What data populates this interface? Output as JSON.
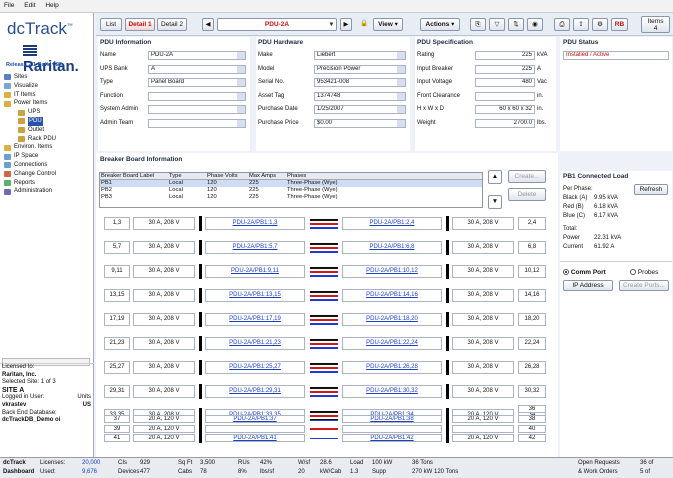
{
  "menu": [
    "File",
    "Edit",
    "Help"
  ],
  "app": {
    "logo": "dcTrack",
    "logo_tm": "™",
    "brand": "Raritan.",
    "release": "Release 2.1 Build 822"
  },
  "tree": [
    {
      "label": "Sites",
      "indent": 0,
      "color": "#5b7fc6"
    },
    {
      "label": "Visualize",
      "indent": 0,
      "color": "#79a6d8"
    },
    {
      "label": "IT Items",
      "indent": 0,
      "color": "#d9b046"
    },
    {
      "label": "Power Items",
      "indent": 0,
      "color": "#d9b046"
    },
    {
      "label": "UPS",
      "indent": 2,
      "color": "#cba23e"
    },
    {
      "label": "PDU",
      "indent": 2,
      "color": "#cba23e",
      "selected": true
    },
    {
      "label": "Outlet",
      "indent": 2,
      "color": "#cba23e"
    },
    {
      "label": "Rack PDU",
      "indent": 2,
      "color": "#cba23e"
    },
    {
      "label": "Environ. Items",
      "indent": 0,
      "color": "#d9b046"
    },
    {
      "label": "IP Space",
      "indent": 0,
      "color": "#6aa0d0"
    },
    {
      "label": "Connections",
      "indent": 0,
      "color": "#6aa0d0"
    },
    {
      "label": "Change Control",
      "indent": 0,
      "color": "#c86a46"
    },
    {
      "label": "Reports",
      "indent": 0,
      "color": "#5bb06a"
    },
    {
      "label": "Administration",
      "indent": 0,
      "color": "#6b6bb8"
    }
  ],
  "license": {
    "l1": "Licensed to:",
    "l2": "Raritan, Inc.",
    "l3": "Selected Site: 1 of 3",
    "l4": "SITE A",
    "l5": "Logged in User:",
    "l5b": "Units",
    "l6": "vkrastev",
    "l6b": "US",
    "l7": "Back End Database:",
    "l8": "dcTrackDB_Demo oi"
  },
  "toolbar": {
    "list": "List",
    "detail1": "Detail 1",
    "detail2": "Detail 2",
    "item": "PDU-2A",
    "view": "View",
    "actions": "Actions",
    "rb": "RB",
    "items_label": "Items",
    "items_count": "4"
  },
  "pdu_info": {
    "title": "PDU Information",
    "fields": [
      {
        "label": "Name",
        "value": "PDU-2A"
      },
      {
        "label": "UPS Bank",
        "value": "A"
      },
      {
        "label": "Type",
        "value": "Panel Board"
      },
      {
        "label": "Function",
        "value": ""
      },
      {
        "label": "System Admin",
        "value": ""
      },
      {
        "label": "Admin Team",
        "value": ""
      }
    ]
  },
  "pdu_hw": {
    "title": "PDU Hardware",
    "fields": [
      {
        "label": "Make",
        "value": "Liebert"
      },
      {
        "label": "Model",
        "value": "Precision Power"
      },
      {
        "label": "Serial No.",
        "value": "953421-008"
      },
      {
        "label": "Asset Tag",
        "value": "1374748"
      },
      {
        "label": "Purchase Date",
        "value": "1/25/2007"
      },
      {
        "label": "Purchase Price",
        "value": "$0.00"
      }
    ]
  },
  "pdu_spec": {
    "title": "PDU Specification",
    "fields": [
      {
        "label": "Rating",
        "value": "225",
        "unit": "kVA"
      },
      {
        "label": "Input Breaker",
        "value": "225",
        "unit": "A"
      },
      {
        "label": "Input Voltage",
        "value": "480",
        "unit": "Vac"
      },
      {
        "label": "Front Clearance",
        "value": "",
        "unit": "in."
      },
      {
        "label": "H x W x D",
        "value": "60 x 60 x 32",
        "unit": "in."
      },
      {
        "label": "Weight",
        "value": "2700.0",
        "unit": "lbs."
      }
    ]
  },
  "pdu_status": {
    "title": "PDU Status",
    "value": "Installed / Active"
  },
  "breaker_board": {
    "title": "Breaker Board Information",
    "headers": [
      "Breaker Board Label",
      "Type",
      "Phase Volts",
      "Max Amps",
      "Phases"
    ],
    "rows": [
      [
        "PB1",
        "Local",
        "120",
        "225",
        "Three-Phase (Wye)"
      ],
      [
        "PB2",
        "Local",
        "120",
        "225",
        "Three-Phase (Wye)"
      ],
      [
        "PB3",
        "Local",
        "120",
        "225",
        "Three-Phase (Wye)"
      ]
    ],
    "create": "Create...",
    "delete": "Delete"
  },
  "breakers": [
    {
      "l": "1,3",
      "la": "30 A, 208 V",
      "ll": "PDU-2A/PB1:1,3",
      "rl": "PDU-2A/PB1:2,4",
      "ra": "30 A, 208 V",
      "r": "2,4"
    },
    {
      "l": "5,7",
      "la": "30 A, 208 V",
      "ll": "PDU-2A/PB1:5,7",
      "rl": "PDU-2A/PB1:6,8",
      "ra": "30 A, 208 V",
      "r": "6,8"
    },
    {
      "l": "9,11",
      "la": "30 A, 208 V",
      "ll": "PDU-2A/PB1:9,11",
      "rl": "PDU-2A/PB1:10,12",
      "ra": "30 A, 208 V",
      "r": "10,12"
    },
    {
      "l": "13,15",
      "la": "30 A, 208 V",
      "ll": "PDU-2A/PB1:13,15",
      "rl": "PDU-2A/PB1:14,16",
      "ra": "30 A, 208 V",
      "r": "14,16"
    },
    {
      "l": "17,19",
      "la": "30 A, 208 V",
      "ll": "PDU-2A/PB1:17,19",
      "rl": "PDU-2A/PB1:18,20",
      "ra": "30 A, 208 V",
      "r": "18,20"
    },
    {
      "l": "21,23",
      "la": "30 A, 208 V",
      "ll": "PDU-2A/PB1:21,23",
      "rl": "PDU-2A/PB1:22,24",
      "ra": "30 A, 208 V",
      "r": "22,24"
    },
    {
      "l": "25,27",
      "la": "30 A, 208 V",
      "ll": "PDU-2A/PB1:25,27",
      "rl": "PDU-2A/PB1:26,28",
      "ra": "30 A, 208 V",
      "r": "26,28"
    },
    {
      "l": "29,31",
      "la": "30 A, 208 V",
      "ll": "PDU-2A/PB1:29,31",
      "rl": "PDU-2A/PB1:30,32",
      "ra": "30 A, 208 V",
      "r": "30,32"
    },
    {
      "l": "33,35",
      "la": "30 A, 208 V",
      "ll": "PDU-2A/PB1:33,35",
      "rl": "PDU-2A/PB1:34",
      "ra": "20 A, 120 V",
      "r": "34"
    }
  ],
  "small_breakers": [
    {
      "l": "37",
      "la": "20 A, 120 V",
      "ll": "PDU-2A/PB1:37",
      "rl": "PDU-2A/PB1:38",
      "ra": "20 A, 120 V",
      "r": "38"
    },
    {
      "l": "39",
      "la": "20 A, 120 V",
      "ll": "",
      "rl": "",
      "ra": "",
      "r": "40"
    },
    {
      "l": "41",
      "la": "20 A, 120 V",
      "ll": "PDU-2A/PB1:41",
      "rl": "PDU-2A/PB1:42",
      "ra": "20 A, 120 V",
      "r": "42"
    }
  ],
  "extra_right": "36",
  "connected_load": {
    "title": "PB1 Connected Load",
    "per_phase": "Per Phase:",
    "refresh": "Refresh",
    "rows": [
      {
        "label": "Black (A)",
        "value": "9.95 kVA"
      },
      {
        "label": "Red (B)",
        "value": "6.18 kVA"
      },
      {
        "label": "Blue (C)",
        "value": "6.17 kVA"
      }
    ],
    "total": "Total:",
    "power_label": "Power",
    "power": "22.31 kVA",
    "current_label": "Current",
    "current": "61.92 A"
  },
  "comm": {
    "comm_port": "Comm Port",
    "probes": "Probes",
    "ip": "IP Address",
    "create_ports": "Create Ports..."
  },
  "status": {
    "app": "dcTrack",
    "dash": "Dashboard",
    "licenses": "Licenses:",
    "used": "Used:",
    "lic_n": "20,000",
    "used_n": "9,676",
    "cols": [
      [
        "CIs",
        "929",
        "Devices",
        "477"
      ],
      [
        "Sq Ft",
        "3,500",
        "Cabs",
        "78"
      ],
      [
        "RUs",
        "42%",
        "8%",
        "lbs/sf"
      ],
      [
        "W/sf",
        "28.6",
        "20",
        "kW/Cab"
      ],
      [
        "Load",
        "100 kW",
        "1.3",
        "Supp"
      ],
      [
        "36 Tons",
        "",
        "270 kW",
        "120 Tons"
      ]
    ],
    "open_req": "Open Requests",
    "open_n": "36 of",
    "work": "& Work Orders",
    "work_n": "5 of"
  }
}
